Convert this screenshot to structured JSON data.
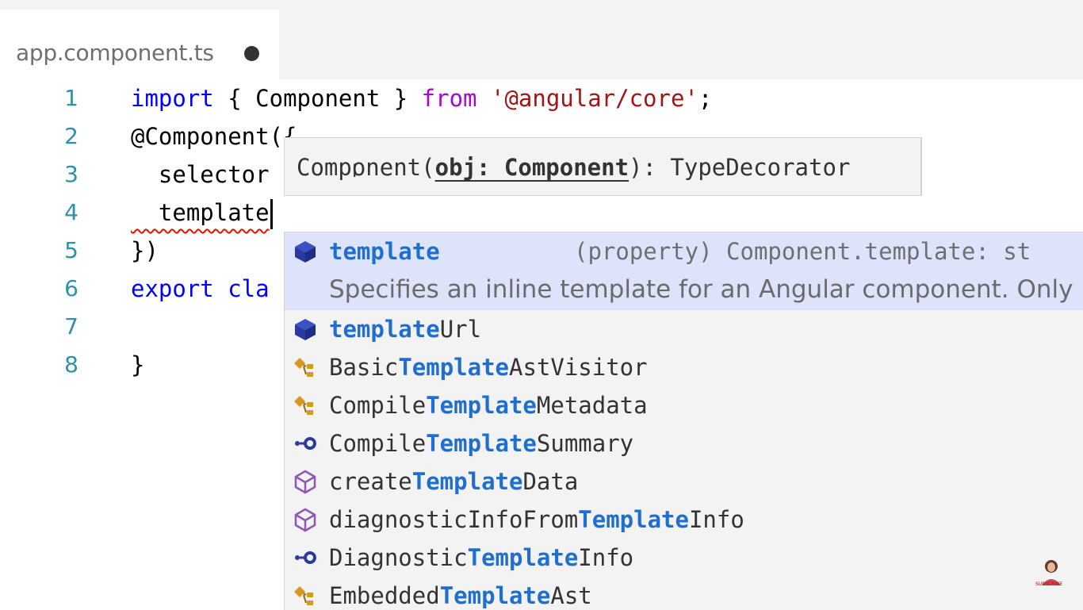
{
  "tab": {
    "title": "app.component.ts"
  },
  "editor": {
    "lines": [
      {
        "number": "1"
      },
      {
        "number": "2"
      },
      {
        "number": "3"
      },
      {
        "number": "4"
      },
      {
        "number": "5"
      },
      {
        "number": "6"
      },
      {
        "number": "7"
      },
      {
        "number": "8"
      }
    ],
    "code": {
      "l1_import": "import",
      "l1_mid": " { Component } ",
      "l1_from": "from",
      "l1_str": "'@angular/core'",
      "l1_end": ";",
      "l2": "@Component({",
      "l3": "  selector",
      "l4": "  template",
      "l5": "})",
      "l6_kw": "export",
      "l6_rest": " cla",
      "l8": "}"
    }
  },
  "signature_hint": {
    "prefix": "Component(",
    "param": "obj: Component",
    "suffix": "): TypeDecorator"
  },
  "suggestions": {
    "selected_detail": "(property) Component.template: st",
    "selected_doc": "Specifies an inline template for an Angular component. Only ...",
    "items": [
      {
        "pre": "",
        "match": "template",
        "post": "",
        "icon": "property-icon"
      },
      {
        "pre": "",
        "match": "template",
        "post": "Url",
        "icon": "property-icon"
      },
      {
        "pre": "Basic",
        "match": "Template",
        "post": "AstVisitor",
        "icon": "class-icon"
      },
      {
        "pre": "Compile",
        "match": "Template",
        "post": "Metadata",
        "icon": "class-icon"
      },
      {
        "pre": "Compile",
        "match": "Template",
        "post": "Summary",
        "icon": "interface-icon"
      },
      {
        "pre": "create",
        "match": "Template",
        "post": "Data",
        "icon": "method-icon"
      },
      {
        "pre": "diagnosticInfoFrom",
        "match": "Template",
        "post": "Info",
        "icon": "method-icon"
      },
      {
        "pre": "Diagnostic",
        "match": "Template",
        "post": "Info",
        "icon": "interface-icon"
      },
      {
        "pre": "Embedded",
        "match": "Template",
        "post": "Ast",
        "icon": "class-icon"
      }
    ]
  },
  "watermark": {
    "label": "SUBSCRIBE"
  },
  "colors": {
    "accent": "#1f6fd1",
    "keyword": "#0000ff",
    "string": "#a31515",
    "line_number": "#2b91af"
  }
}
